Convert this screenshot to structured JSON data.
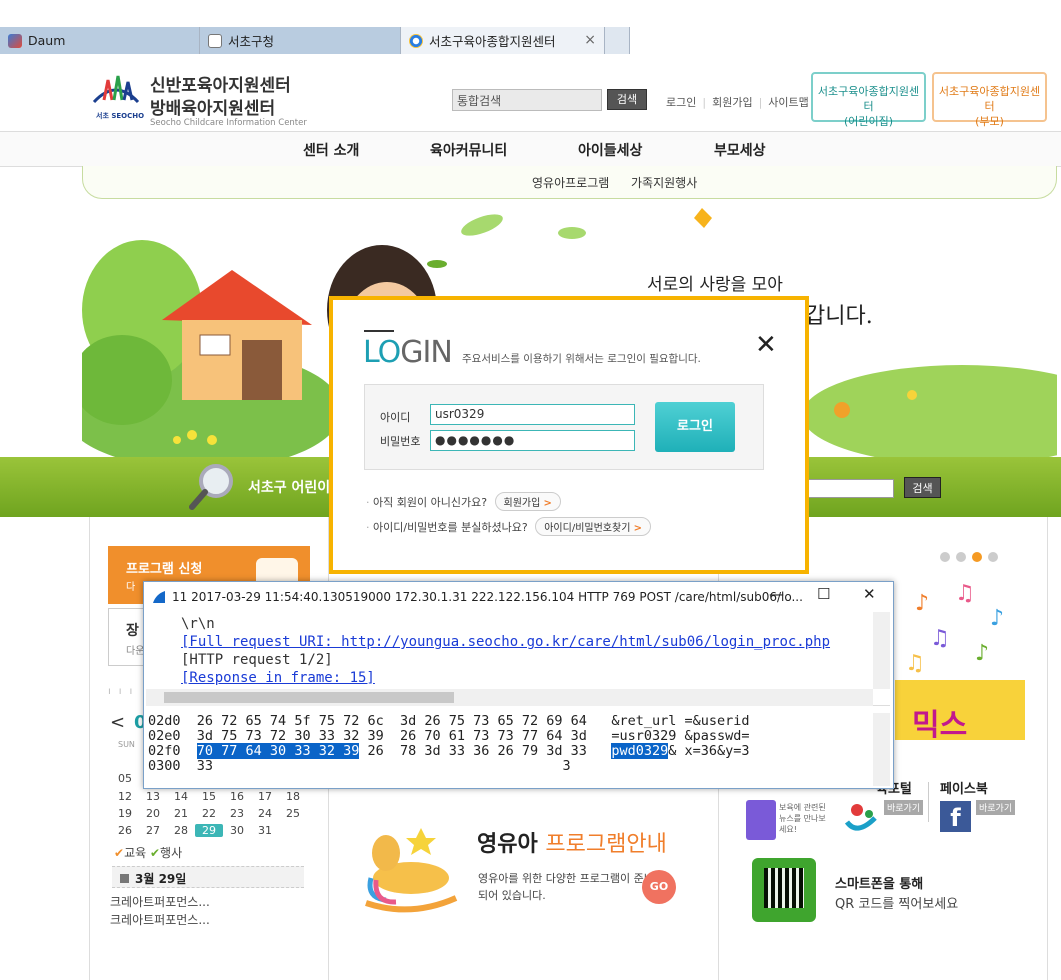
{
  "browser": {
    "tabs": [
      {
        "label": "Daum"
      },
      {
        "label": "서초구청"
      },
      {
        "label": "서초구육아종합지원센터"
      }
    ],
    "close_glyph": "×"
  },
  "header": {
    "logo_text": "서초 SEOCHO",
    "title_line1": "신반포육아지원센터",
    "title_line2": "방배육아지원센터",
    "subtitle": "Seocho Childcare Information Center",
    "search_placeholder": "통합검색",
    "search_button": "검색",
    "links": [
      "로그인",
      "회원가입",
      "사이트맵"
    ],
    "separator": "|",
    "center_btn1_line1": "서초구육아종합지원센터",
    "center_btn1_line2": "(어린이집)",
    "center_btn2_line1": "서초구육아종합지원센터",
    "center_btn2_line2": "(부모)"
  },
  "gnb": {
    "items": [
      "센터 소개",
      "육아커뮤니티",
      "아이들세상",
      "부모세상"
    ],
    "sub_items": [
      "영유아프로그램",
      "가족지원행사"
    ]
  },
  "hero": {
    "line1": "서로의 사랑을 모아",
    "line2": "갑니다."
  },
  "green_bar": {
    "label": "서초구 어린이",
    "search_button": "검색"
  },
  "left": {
    "program_title": "프로그램 신청",
    "program_sub": "다",
    "box2_title": "장",
    "box2_sub": "다운",
    "cal_prev": "<",
    "cal_month": "0",
    "cal_sun": "SUN",
    "calendar_rows": [
      [
        "05"
      ],
      [
        "12",
        "13",
        "14",
        "15",
        "16",
        "17",
        "18"
      ],
      [
        "19",
        "20",
        "21",
        "22",
        "23",
        "24",
        "25"
      ],
      [
        "26",
        "27",
        "28",
        "29",
        "30",
        "31"
      ]
    ],
    "today": "29",
    "legend_edu": "교육",
    "legend_event": "행사",
    "date_label": "3월 29일",
    "events": [
      "크레아트퍼포먼스...",
      "크레아트퍼포먼스..."
    ]
  },
  "middle": {
    "ya_title_a": "영유아",
    "ya_title_b": "프로그램안내",
    "ya_desc": "영유아를 위한 다양한 프로그램이 준비되어 있습니다.",
    "go": "GO"
  },
  "right": {
    "mix_text": "믹스",
    "portal_label": "육포털",
    "facebook_label": "페이스북",
    "go_label": "바로가기",
    "news_text": "보육에 관련된 뉴스를 만나보세요!",
    "qr_line1": "스마트폰을 통해",
    "qr_line2": "QR 코드를 찍어보세요"
  },
  "login": {
    "title_a": "LO",
    "title_b": "GIN",
    "desc": "주요서비스를 이용하기 위해서는 로그인이 필요합니다.",
    "close": "✕",
    "id_label": "아이디",
    "pw_label": "비밀번호",
    "id_value": "usr0329",
    "pw_value": "●●●●●●●",
    "login_button": "로그인",
    "q1": "아직 회원이 아니신가요?",
    "q1_btn": "회원가입",
    "q2": "아이디/비밀번호를 분실하셨나요?",
    "q2_btn": "아이디/비밀번호찾기",
    "chev": ">"
  },
  "wireshark": {
    "title": "11 2017-03-29 11:54:40.130519000 172.30.1.31 222.122.156.104 HTTP 769 POST /care/html/sub06/lo...",
    "min": "—",
    "max": "☐",
    "close": "✕",
    "detail_lines": [
      "\\r\\n",
      "[Full request URI: http://youngua.seocho.go.kr/care/html/sub06/login_proc.php",
      "[HTTP request 1/2]",
      "[Response in frame: 15]"
    ],
    "hex_rows": [
      {
        "offset": "02d0",
        "a": "26 72 65 74 5f 75 72 6c",
        "b": "3d 26 75 73 65 72 69 64",
        "ascii": "&ret_url =&userid"
      },
      {
        "offset": "02e0",
        "a": "3d 75 73 72 30 33 32 39",
        "b": "26 70 61 73 73 77 64 3d",
        "ascii": "=usr0329 &passwd="
      },
      {
        "offset": "02f0",
        "a_hl": "70 77 64 30 33 32 39",
        "a_rest": " 26",
        "b": "78 3d 33 36 26 79 3d 33",
        "ascii_hl": "pwd0329",
        "ascii_rest": "& x=36&y=3"
      },
      {
        "offset": "0300",
        "a": "33",
        "b": "",
        "ascii": "3"
      }
    ]
  },
  "colors": {
    "accent_teal": "#1d9fb3",
    "green_bar": "#7fb12a",
    "orange": "#f08f2c",
    "login_border": "#f7b300",
    "hex_highlight": "#0a64c8"
  }
}
